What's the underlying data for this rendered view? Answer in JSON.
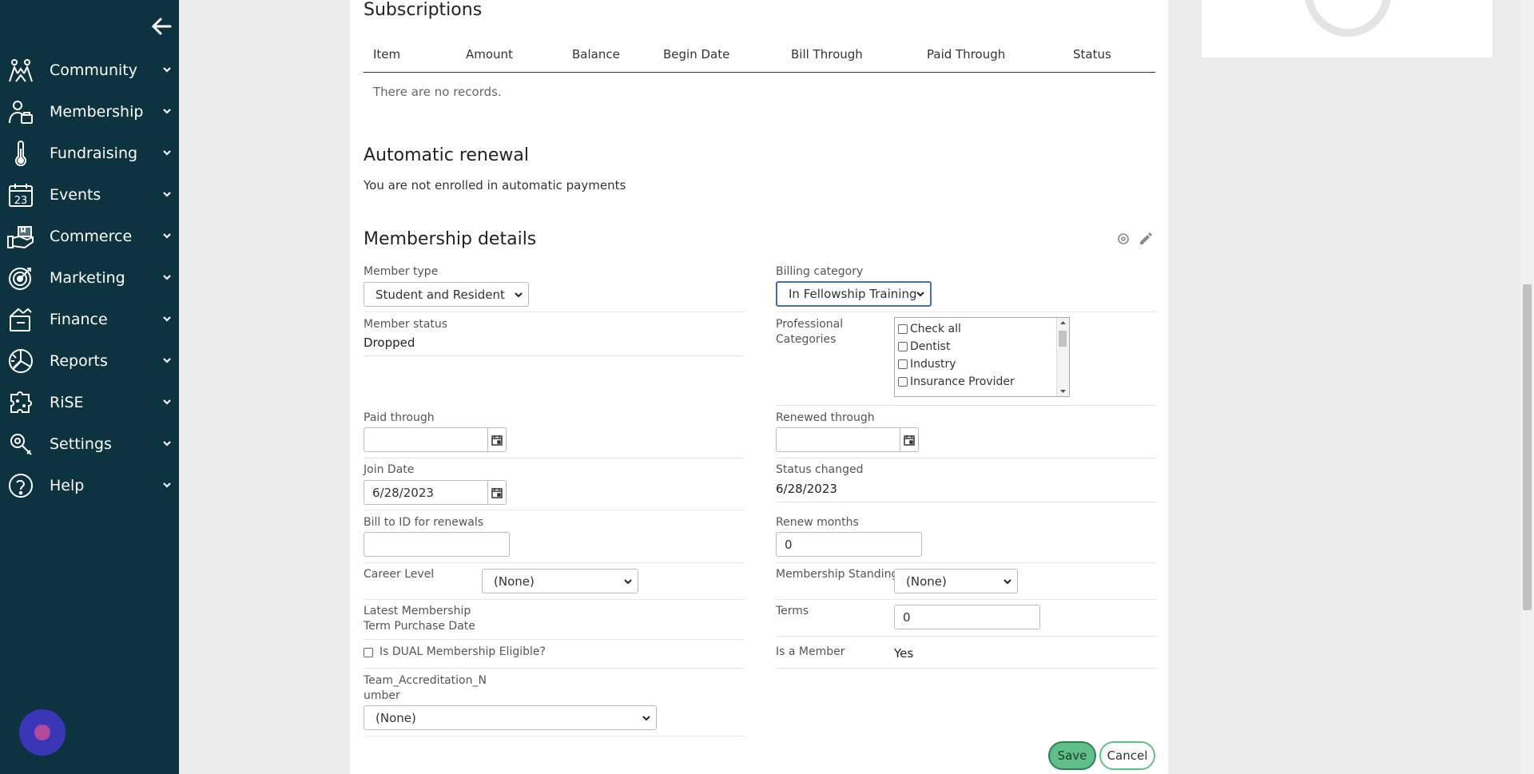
{
  "sidebar": {
    "back_icon": "arrow-left-icon",
    "items": [
      {
        "label": "Community",
        "icon": "community-icon"
      },
      {
        "label": "Membership",
        "icon": "membership-icon"
      },
      {
        "label": "Fundraising",
        "icon": "thermometer-icon"
      },
      {
        "label": "Events",
        "icon": "calendar-icon"
      },
      {
        "label": "Commerce",
        "icon": "commerce-icon"
      },
      {
        "label": "Marketing",
        "icon": "target-icon"
      },
      {
        "label": "Finance",
        "icon": "finance-icon"
      },
      {
        "label": "Reports",
        "icon": "reports-icon"
      },
      {
        "label": "RiSE",
        "icon": "puzzle-icon"
      },
      {
        "label": "Settings",
        "icon": "wrench-icon"
      },
      {
        "label": "Help",
        "icon": "help-icon"
      }
    ],
    "events_icon_number": "23"
  },
  "subscriptions": {
    "title": "Subscriptions",
    "columns": [
      "Item",
      "Amount",
      "Balance",
      "Begin Date",
      "Bill Through",
      "Paid Through",
      "Status"
    ],
    "empty_text": "There are no records."
  },
  "auto_renewal": {
    "title": "Automatic renewal",
    "text": "You are not enrolled in automatic payments"
  },
  "details": {
    "title": "Membership details",
    "member_type": {
      "label": "Member type",
      "value": "Student and Resident"
    },
    "billing_category": {
      "label": "Billing category",
      "value": "In Fellowship Training"
    },
    "member_status": {
      "label": "Member status",
      "value": "Dropped"
    },
    "professional_categories": {
      "label_line1": "Professional",
      "label_line2": "Categories",
      "options": [
        "Check all",
        "Dentist",
        "Industry",
        "Insurance Provider"
      ]
    },
    "paid_through": {
      "label": "Paid through",
      "value": ""
    },
    "renewed_through": {
      "label": "Renewed through",
      "value": ""
    },
    "join_date": {
      "label": "Join Date",
      "value": "6/28/2023"
    },
    "status_changed": {
      "label": "Status changed",
      "value": "6/28/2023"
    },
    "bill_to_id": {
      "label": "Bill to ID for renewals",
      "value": ""
    },
    "renew_months": {
      "label": "Renew months",
      "value": "0"
    },
    "career_level": {
      "label": "Career Level",
      "value": "(None)"
    },
    "membership_standing": {
      "label": "Membership Standing",
      "value": "(None)"
    },
    "latest_purchase": {
      "label_line1": "Latest Membership",
      "label_line2": "Term Purchase Date"
    },
    "terms": {
      "label": "Terms",
      "value": "0"
    },
    "dual_eligible": {
      "label": "Is DUAL Membership Eligible?"
    },
    "is_member": {
      "label": "Is a Member",
      "value": "Yes"
    },
    "team_accreditation": {
      "label_line1": "Team_Accreditation_N",
      "label_line2": "umber",
      "value": "(None)"
    }
  },
  "buttons": {
    "save": "Save",
    "cancel": "Cancel"
  },
  "colors": {
    "sidebar_bg": "#0d3340",
    "save_green": "#5fbf8a",
    "chat_purple": "#3b36b8"
  }
}
